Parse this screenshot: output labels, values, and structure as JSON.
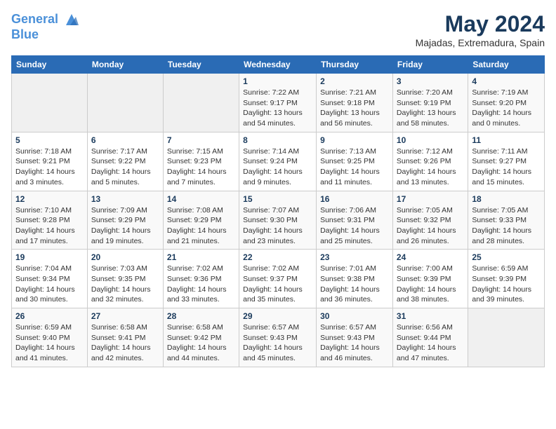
{
  "header": {
    "logo_line1": "General",
    "logo_line2": "Blue",
    "month_title": "May 2024",
    "location": "Majadas, Extremadura, Spain"
  },
  "days_of_week": [
    "Sunday",
    "Monday",
    "Tuesday",
    "Wednesday",
    "Thursday",
    "Friday",
    "Saturday"
  ],
  "weeks": [
    [
      {
        "day": "",
        "info": ""
      },
      {
        "day": "",
        "info": ""
      },
      {
        "day": "",
        "info": ""
      },
      {
        "day": "1",
        "info": "Sunrise: 7:22 AM\nSunset: 9:17 PM\nDaylight: 13 hours\nand 54 minutes."
      },
      {
        "day": "2",
        "info": "Sunrise: 7:21 AM\nSunset: 9:18 PM\nDaylight: 13 hours\nand 56 minutes."
      },
      {
        "day": "3",
        "info": "Sunrise: 7:20 AM\nSunset: 9:19 PM\nDaylight: 13 hours\nand 58 minutes."
      },
      {
        "day": "4",
        "info": "Sunrise: 7:19 AM\nSunset: 9:20 PM\nDaylight: 14 hours\nand 0 minutes."
      }
    ],
    [
      {
        "day": "5",
        "info": "Sunrise: 7:18 AM\nSunset: 9:21 PM\nDaylight: 14 hours\nand 3 minutes."
      },
      {
        "day": "6",
        "info": "Sunrise: 7:17 AM\nSunset: 9:22 PM\nDaylight: 14 hours\nand 5 minutes."
      },
      {
        "day": "7",
        "info": "Sunrise: 7:15 AM\nSunset: 9:23 PM\nDaylight: 14 hours\nand 7 minutes."
      },
      {
        "day": "8",
        "info": "Sunrise: 7:14 AM\nSunset: 9:24 PM\nDaylight: 14 hours\nand 9 minutes."
      },
      {
        "day": "9",
        "info": "Sunrise: 7:13 AM\nSunset: 9:25 PM\nDaylight: 14 hours\nand 11 minutes."
      },
      {
        "day": "10",
        "info": "Sunrise: 7:12 AM\nSunset: 9:26 PM\nDaylight: 14 hours\nand 13 minutes."
      },
      {
        "day": "11",
        "info": "Sunrise: 7:11 AM\nSunset: 9:27 PM\nDaylight: 14 hours\nand 15 minutes."
      }
    ],
    [
      {
        "day": "12",
        "info": "Sunrise: 7:10 AM\nSunset: 9:28 PM\nDaylight: 14 hours\nand 17 minutes."
      },
      {
        "day": "13",
        "info": "Sunrise: 7:09 AM\nSunset: 9:29 PM\nDaylight: 14 hours\nand 19 minutes."
      },
      {
        "day": "14",
        "info": "Sunrise: 7:08 AM\nSunset: 9:29 PM\nDaylight: 14 hours\nand 21 minutes."
      },
      {
        "day": "15",
        "info": "Sunrise: 7:07 AM\nSunset: 9:30 PM\nDaylight: 14 hours\nand 23 minutes."
      },
      {
        "day": "16",
        "info": "Sunrise: 7:06 AM\nSunset: 9:31 PM\nDaylight: 14 hours\nand 25 minutes."
      },
      {
        "day": "17",
        "info": "Sunrise: 7:05 AM\nSunset: 9:32 PM\nDaylight: 14 hours\nand 26 minutes."
      },
      {
        "day": "18",
        "info": "Sunrise: 7:05 AM\nSunset: 9:33 PM\nDaylight: 14 hours\nand 28 minutes."
      }
    ],
    [
      {
        "day": "19",
        "info": "Sunrise: 7:04 AM\nSunset: 9:34 PM\nDaylight: 14 hours\nand 30 minutes."
      },
      {
        "day": "20",
        "info": "Sunrise: 7:03 AM\nSunset: 9:35 PM\nDaylight: 14 hours\nand 32 minutes."
      },
      {
        "day": "21",
        "info": "Sunrise: 7:02 AM\nSunset: 9:36 PM\nDaylight: 14 hours\nand 33 minutes."
      },
      {
        "day": "22",
        "info": "Sunrise: 7:02 AM\nSunset: 9:37 PM\nDaylight: 14 hours\nand 35 minutes."
      },
      {
        "day": "23",
        "info": "Sunrise: 7:01 AM\nSunset: 9:38 PM\nDaylight: 14 hours\nand 36 minutes."
      },
      {
        "day": "24",
        "info": "Sunrise: 7:00 AM\nSunset: 9:39 PM\nDaylight: 14 hours\nand 38 minutes."
      },
      {
        "day": "25",
        "info": "Sunrise: 6:59 AM\nSunset: 9:39 PM\nDaylight: 14 hours\nand 39 minutes."
      }
    ],
    [
      {
        "day": "26",
        "info": "Sunrise: 6:59 AM\nSunset: 9:40 PM\nDaylight: 14 hours\nand 41 minutes."
      },
      {
        "day": "27",
        "info": "Sunrise: 6:58 AM\nSunset: 9:41 PM\nDaylight: 14 hours\nand 42 minutes."
      },
      {
        "day": "28",
        "info": "Sunrise: 6:58 AM\nSunset: 9:42 PM\nDaylight: 14 hours\nand 44 minutes."
      },
      {
        "day": "29",
        "info": "Sunrise: 6:57 AM\nSunset: 9:43 PM\nDaylight: 14 hours\nand 45 minutes."
      },
      {
        "day": "30",
        "info": "Sunrise: 6:57 AM\nSunset: 9:43 PM\nDaylight: 14 hours\nand 46 minutes."
      },
      {
        "day": "31",
        "info": "Sunrise: 6:56 AM\nSunset: 9:44 PM\nDaylight: 14 hours\nand 47 minutes."
      },
      {
        "day": "",
        "info": ""
      }
    ]
  ]
}
